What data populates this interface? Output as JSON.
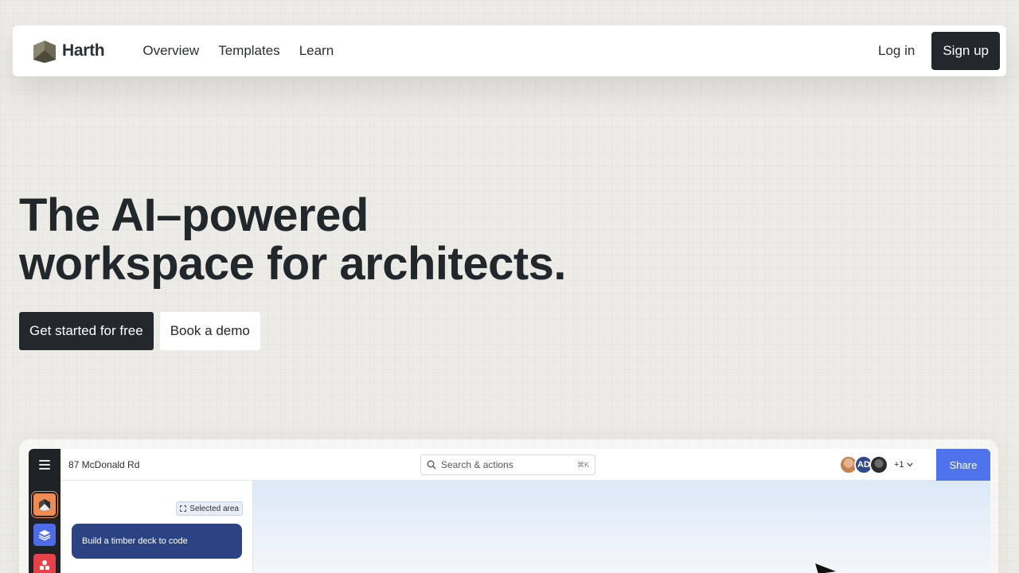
{
  "nav": {
    "brand": "Harth",
    "links": [
      "Overview",
      "Templates",
      "Learn"
    ],
    "login": "Log in",
    "signup": "Sign up"
  },
  "hero": {
    "line1": "The AI–powered",
    "line2": "workspace for architects.",
    "cta_primary": "Get started for free",
    "cta_secondary": "Book a demo"
  },
  "app": {
    "project_name": "87 McDonald Rd",
    "search_placeholder": "Search & actions",
    "search_shortcut": "⌘K",
    "avatar_initials": "AD",
    "extra_collaborators": "+1",
    "share_label": "Share",
    "selection_tag": "Selected area",
    "chat_prompt": "Build a timber deck to code"
  },
  "colors": {
    "accent_blue": "#4f73ea",
    "dark": "#22282c",
    "rail_orange": "#f08b56",
    "rail_blue": "#4d6be8",
    "rail_red": "#e8434a",
    "chat_bubble": "#2c4383"
  },
  "icons": [
    "harth-logo-icon",
    "menu-icon",
    "home-icon",
    "layers-icon",
    "shapes-icon",
    "search-icon",
    "chevron-down-icon",
    "selection-icon",
    "cursor-icon"
  ]
}
